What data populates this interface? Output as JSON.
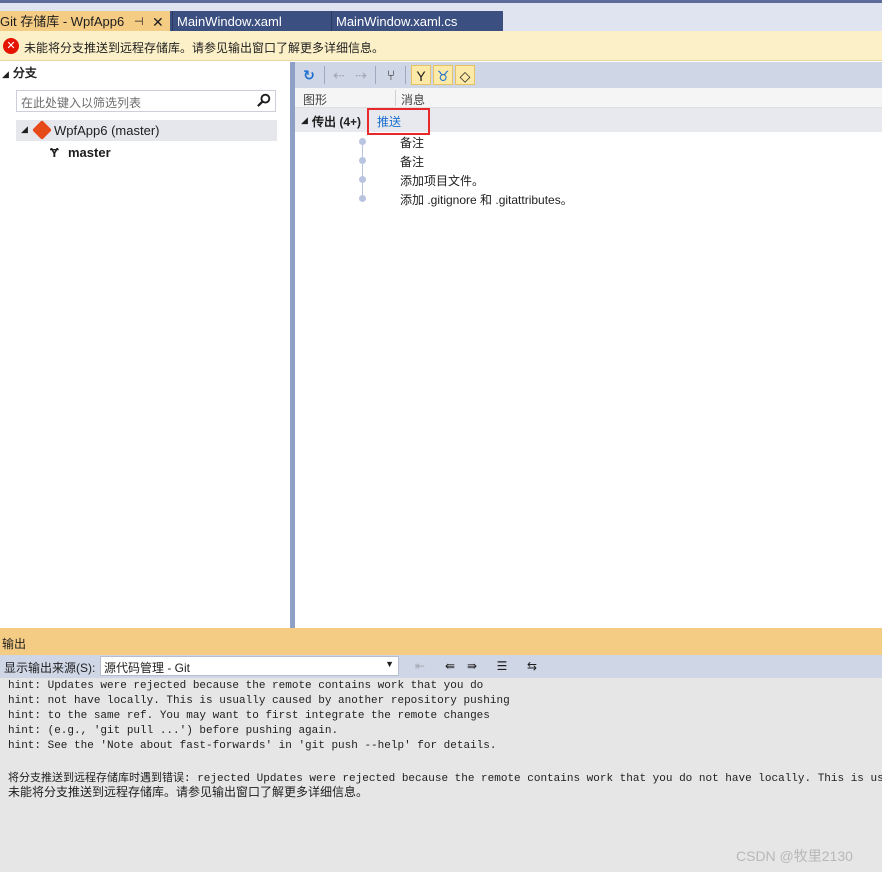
{
  "tabs": [
    {
      "label": "Git 存储库 - WpfApp6",
      "pin": "⊣",
      "close": "✕"
    },
    {
      "label": "MainWindow.xaml"
    },
    {
      "label": "MainWindow.xaml.cs"
    }
  ],
  "infobar": {
    "icon": "x-error-icon",
    "message": "未能将分支推送到远程存储库。请参见输出窗口了解更多详细信息。"
  },
  "left": {
    "header": "分支",
    "filter_placeholder": "在此处键入以筛选列表",
    "repo_label": "WpfApp6 (master)",
    "branch_label": "master"
  },
  "right": {
    "columns": {
      "graph": "图形",
      "message": "消息"
    },
    "outgoing_label": "传出 (4+)",
    "push_link": "推送",
    "commits": [
      "备注",
      "备注",
      "添加项目文件。",
      "添加 .gitignore 和 .gitattributes。"
    ]
  },
  "output": {
    "title": "输出",
    "source_label": "显示输出来源(S):",
    "source_value": "源代码管理 - Git",
    "lines": [
      "hint: Updates were rejected because the remote contains work that you do",
      "hint: not have locally. This is usually caused by another repository pushing",
      "hint: to the same ref. You may want to first integrate the remote changes",
      "hint: (e.g., 'git pull ...') before pushing again.",
      "hint: See the 'Note about fast-forwards' in 'git push --help' for details.",
      "将分支推送到远程存储库时遇到错误: rejected Updates were rejected because the remote contains work that you do not have locally. This is usually caused",
      "未能将分支推送到远程存储库。请参见输出窗口了解更多详细信息。"
    ]
  },
  "watermark": "CSDN @牧里2130",
  "colors": {
    "accent": "#f5cc84",
    "tab_bg": "#3b4f81",
    "error": "#e51400",
    "link": "#1a6fd0",
    "highlight_box": "#e8282b"
  }
}
